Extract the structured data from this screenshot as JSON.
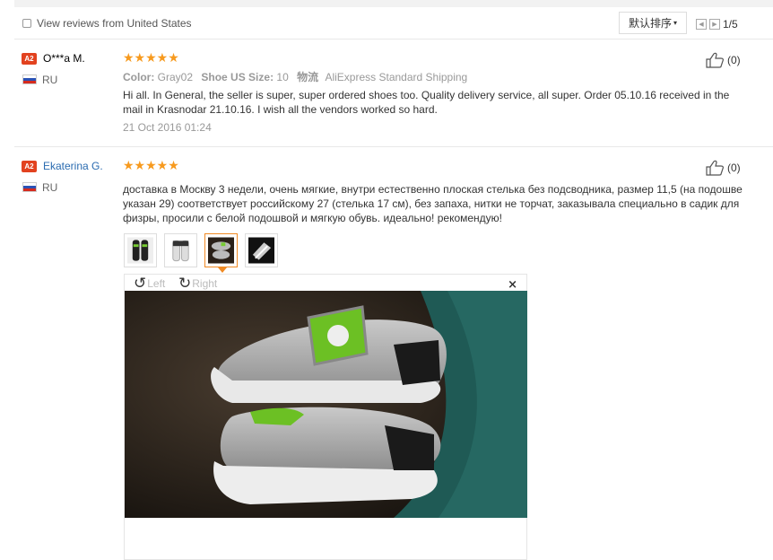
{
  "toolbar": {
    "filter_label": "View reviews from United States",
    "sort_label": "默认排序",
    "page_indicator": "1/5"
  },
  "reviews": [
    {
      "level_badge": "A2",
      "username": "O***a M.",
      "country": "RU",
      "rating": 5,
      "stars": "★★★★★",
      "likes": "(0)",
      "color_label": "Color:",
      "color_value": "Gray02",
      "size_label": "Shoe US Size:",
      "size_value": "10",
      "shipping_icon_text": "物流",
      "shipping_value": "AliExpress Standard Shipping",
      "text": "Hi all. In General, the seller is super, super ordered shoes too. Quality delivery service, all super. Order 05.10.16 received in the mail in Krasnodar 21.10.16. I wish all the vendors worked so hard.",
      "date": "21 Oct 2016 01:24"
    },
    {
      "level_badge": "A2",
      "username": "Ekaterina G.",
      "country": "RU",
      "rating": 5,
      "stars": "★★★★★",
      "likes": "(0)",
      "text": "доставка в Москву 3 недели, очень мягкие, внутри естественно плоская стелька без подсводника, размер 11,5 (на подошве указан 29) соответствует российскому 27 (стелька 17 см), без запаха, нитки не торчат, заказывала специально в садик для физры, просили с белой подошвой и мягкую обувь. идеально! рекомендую!",
      "photo_count": 4,
      "selected_photo": 3,
      "viewer": {
        "rotate_left_label": "Left",
        "rotate_right_label": "Right",
        "close_symbol": "×"
      }
    }
  ],
  "icons": {
    "flag": "russia-flag-icon",
    "like": "thumbs-up-icon",
    "rotate_left": "rotate-left-icon",
    "rotate_right": "rotate-right-icon"
  },
  "colors": {
    "badge": "#e2421f",
    "star": "#f79a1e",
    "link": "#2a6bb0",
    "selected_thumb": "#f08a24"
  }
}
